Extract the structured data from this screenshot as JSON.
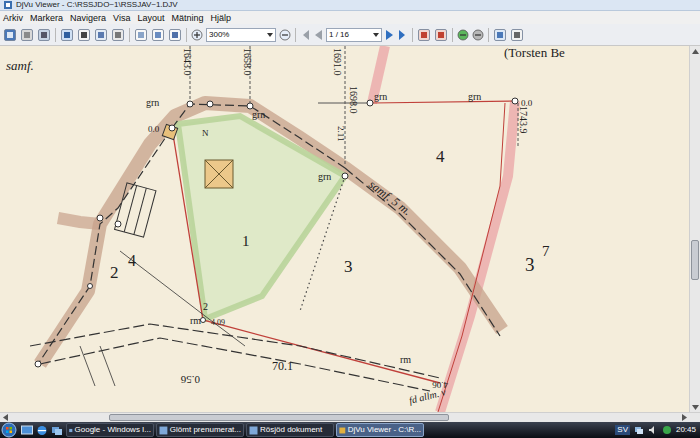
{
  "window": {
    "title": "DjVu Viewer - C:\\RSSJDO~1\\RSSJAV~1.DJV"
  },
  "menu": [
    "Arkiv",
    "Markera",
    "Navigera",
    "Visa",
    "Layout",
    "Mätning",
    "Hjälp"
  ],
  "toolbar": {
    "zoom": "300%",
    "page": "1 / 16"
  },
  "map": {
    "labels": [
      "samf.",
      "1643.0",
      "1658.0",
      "1691.0",
      "1698.0",
      "2.11",
      "1743.9",
      "grn",
      "0.0",
      "N",
      "grn",
      "grn",
      "grn",
      "0.0",
      "(Torsten Be",
      "grn",
      "4",
      "1",
      "3",
      "3",
      "7",
      "2",
      "4",
      "samf. 5 m.",
      "rm",
      "2",
      "4.09",
      "70.1",
      "0.56",
      "rm",
      "4.06",
      "fd allm. v"
    ]
  },
  "scrollbars": {
    "vertical": {
      "level": 0.6
    },
    "horizontal": {
      "level": 0.3
    }
  },
  "taskbar": {
    "items": [
      {
        "label": "Google - Windows I...",
        "selected": false
      },
      {
        "label": "Glömt prenumerat...",
        "selected": false
      },
      {
        "label": "Rösjöd dokument",
        "selected": false
      },
      {
        "label": "DjVu Viewer - C:\\R...",
        "selected": true
      }
    ],
    "language": "SV",
    "time": "20:45"
  }
}
